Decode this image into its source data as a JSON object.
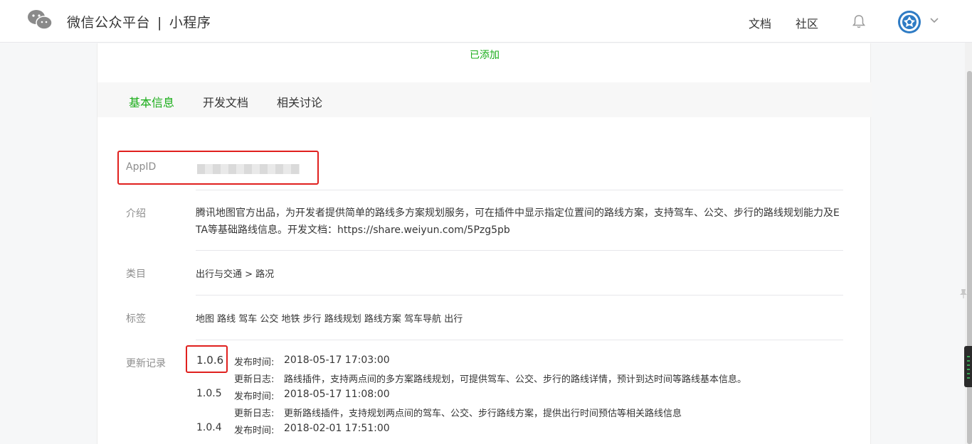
{
  "header": {
    "brand_main": "微信公众平台",
    "brand_sep": "|",
    "brand_sub": "小程序",
    "nav": [
      {
        "label": "文档"
      },
      {
        "label": "社区"
      }
    ]
  },
  "status": {
    "added_label": "已添加"
  },
  "tabs": [
    {
      "label": "基本信息",
      "active": true
    },
    {
      "label": "开发文档",
      "active": false
    },
    {
      "label": "相关讨论",
      "active": false
    }
  ],
  "info": {
    "appid_label": "AppID",
    "intro_label": "介绍",
    "intro_value": "腾讯地图官方出品，为开发者提供简单的路线多方案规划服务，可在插件中显示指定位置间的路线方案，支持驾车、公交、步行的路线规划能力及ETA等基础路线信息。开发文档：https://share.weiyun.com/5Pzg5pb",
    "category_label": "类目",
    "category_value": "出行与交通 > 路况",
    "tags_label": "标签",
    "tags_value": "地图 路线 驾车 公交 地铁 步行 路线规划 路线方案 驾车导航 出行",
    "changelog_label": "更新记录"
  },
  "changelog": [
    {
      "version": "1.0.6",
      "time_label": "发布时间:",
      "time": "2018-05-17 17:03:00",
      "log_label": "更新日志:",
      "log": "路线插件，支持两点间的多方案路线规划，可提供驾车、公交、步行的路线详情，预计到达时间等路线基本信息。"
    },
    {
      "version": "1.0.5",
      "time_label": "发布时间:",
      "time": "2018-05-17 11:08:00",
      "log_label": "更新日志:",
      "log": "更新路线插件，支持规划两点间的驾车、公交、步行路线方案，提供出行时间预估等相关路线信息"
    },
    {
      "version": "1.0.4",
      "time_label": "发布时间:",
      "time": "2018-02-01 17:51:00"
    }
  ],
  "colors": {
    "accent_green": "#1aad19",
    "highlight_red": "#e0201e"
  }
}
